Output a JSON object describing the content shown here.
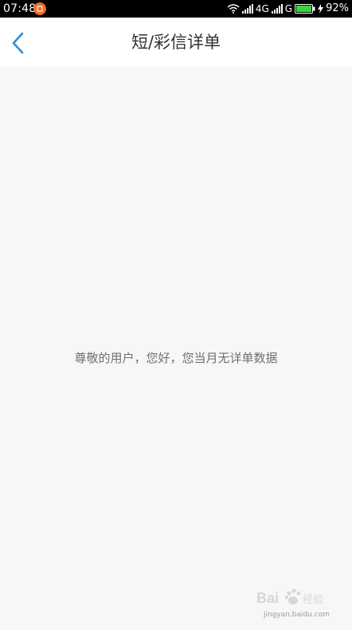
{
  "status_bar": {
    "time": "07:48",
    "network_1": "4G",
    "network_2": "G",
    "battery_percent": "92%",
    "icons": [
      "notification-icon",
      "wifi-icon",
      "signal-icon",
      "signal-icon",
      "battery-icon",
      "charging-icon"
    ]
  },
  "header": {
    "back_icon": "chevron-left-icon",
    "title": "短/彩信详单"
  },
  "main": {
    "empty_message": "尊敬的用户，您好，您当月无详单数据"
  },
  "watermark": {
    "brand": "Bai du 经验",
    "url": "jingyan.baidu.com"
  },
  "colors": {
    "accent": "#2c8fd6",
    "title_text": "#333333",
    "message_text": "#6f6f6f",
    "background": "#f7f7f7",
    "status_bar": "#000000",
    "notification": "#f06a22",
    "battery": "#3fd23f"
  }
}
